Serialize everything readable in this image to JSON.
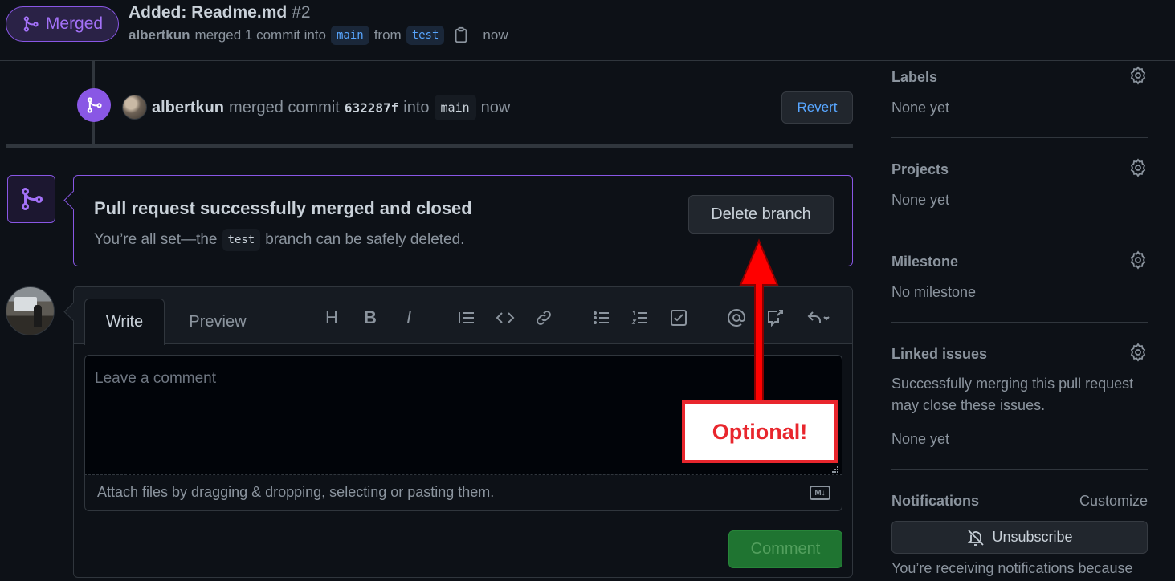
{
  "header": {
    "badge_label": "Merged",
    "title": "Added: Readme.md",
    "number": "#2",
    "author": "albertkun",
    "merged_text": "merged 1 commit into",
    "base_branch": "main",
    "from_text": "from",
    "head_branch": "test",
    "time": "now"
  },
  "merge_event": {
    "author": "albertkun",
    "merged_commit_text": "merged commit",
    "sha": "632287f",
    "into_text": "into",
    "branch": "main",
    "time": "now",
    "revert_label": "Revert"
  },
  "merged_box": {
    "heading": "Pull request successfully merged and closed",
    "sub_prefix": "You’re all set—the",
    "branch": "test",
    "sub_suffix": "branch can be safely deleted.",
    "delete_label": "Delete branch"
  },
  "comment": {
    "tabs": [
      "Write",
      "Preview"
    ],
    "placeholder": "Leave a comment",
    "attach_text": "Attach files by dragging & dropping, selecting or pasting them.",
    "markdown_badge": "M↓",
    "submit_label": "Comment"
  },
  "annotation": {
    "callout": "Optional!",
    "color": "#e8262d"
  },
  "sidebar": {
    "labels": {
      "title": "Labels",
      "value": "None yet"
    },
    "projects": {
      "title": "Projects",
      "value": "None yet"
    },
    "milestone": {
      "title": "Milestone",
      "value": "No milestone"
    },
    "linked_issues": {
      "title": "Linked issues",
      "desc_line1": "Successfully merging this pull request",
      "desc_line2": "may close these issues.",
      "value": "None yet"
    },
    "notifications": {
      "title": "Notifications",
      "customize": "Customize",
      "unsubscribe": "Unsubscribe",
      "reason": "You’re receiving notifications because"
    }
  },
  "colors": {
    "background": "#0d1117",
    "merged_purple": "#8957e5",
    "link_blue": "#58a6ff",
    "comment_green": "#238636"
  }
}
